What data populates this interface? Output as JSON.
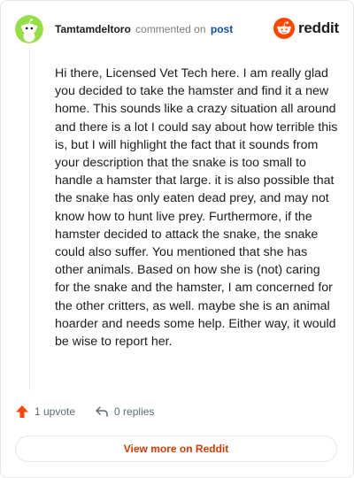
{
  "header": {
    "username": "Tamtamdeltoro",
    "commented_text": "commented on",
    "post_link": "post"
  },
  "brand": {
    "wordmark": "reddit",
    "icon": "reddit-logo-icon",
    "color": "#ff4500"
  },
  "comment": {
    "body": "Hi there, Licensed Vet Tech here. I am really glad you decided to take the hamster and find it a new home. This sounds like a crazy situation all around and there is a lot I could say about how terrible this is, but I will highlight the fact that it sounds from your description that the snake is too small to handle a hamster that large. it is also possible that the snake has only eaten dead prey, and may not know how to hunt live prey. Furthermore, if the hamster decided to attack the snake, the snake could also suffer. You mentioned that she has other animals. Based on how she is (not) caring for the snake and the hamster, I am concerned for the other critters, as well. maybe she is an animal hoarder and needs some help. Either way, it would be wise to report her."
  },
  "actions": {
    "upvotes_label": "1 upvote",
    "replies_label": "0 replies",
    "upvote_icon": "upvote-arrow-icon",
    "reply_icon": "reply-arrow-icon",
    "upvote_color": "#ff4500"
  },
  "footer": {
    "view_more_label": "View more on Reddit",
    "link_color": "#d93a00"
  },
  "avatar": {
    "icon": "snoo-avatar-icon",
    "color": "#94e044"
  }
}
